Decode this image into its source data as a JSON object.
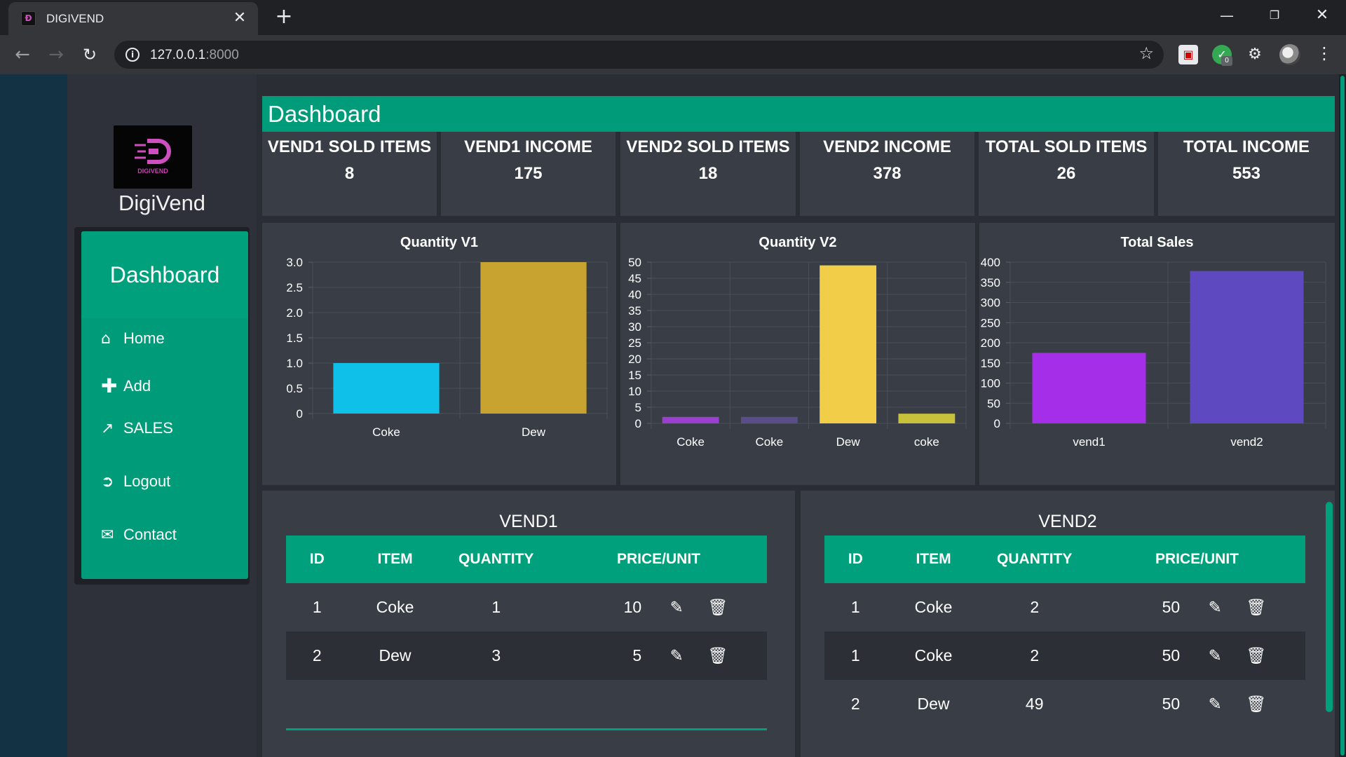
{
  "browser": {
    "tab_title": "DIGIVEND",
    "tab_favicon": "Đ",
    "tab_close": "✕",
    "new_tab": "+",
    "url_host": "127.0.0.1",
    "url_port": ":8000",
    "ext_badge": "0",
    "icons": [
      "back-icon",
      "forward-icon",
      "reload-icon",
      "info-icon",
      "star-icon",
      "puzzle-icon",
      "menu-icon"
    ]
  },
  "sidebar": {
    "logo_text": "DIGIVEND",
    "brand": "DigiVend",
    "title": "Dashboard",
    "items": [
      {
        "label": "Home",
        "icon": "home-icon"
      },
      {
        "label": "Add",
        "icon": "plus-icon"
      },
      {
        "label": "SALES",
        "icon": "chart-icon"
      },
      {
        "label": "Logout",
        "icon": "logout-icon"
      },
      {
        "label": "Contact",
        "icon": "envelope-icon"
      }
    ]
  },
  "header": {
    "title": "Dashboard"
  },
  "stats": [
    {
      "label": "VEND1 SOLD ITEMS",
      "value": "8"
    },
    {
      "label": "VEND1 INCOME",
      "value": "175"
    },
    {
      "label": "VEND2 SOLD ITEMS",
      "value": "18"
    },
    {
      "label": "VEND2 INCOME",
      "value": "378"
    },
    {
      "label": "TOTAL SOLD ITEMS",
      "value": "26"
    },
    {
      "label": "TOTAL INCOME",
      "value": "553"
    }
  ],
  "chart_data": [
    {
      "type": "bar",
      "title": "Quantity V1",
      "categories": [
        "Coke",
        "Dew"
      ],
      "values": [
        1,
        3
      ],
      "colors": [
        "#0fc0e8",
        "#c9a32f"
      ],
      "ylim": [
        0,
        3
      ],
      "yticks": [
        "0",
        "0.5",
        "1.0",
        "1.5",
        "2.0",
        "2.5",
        "3.0"
      ],
      "grid": true
    },
    {
      "type": "bar",
      "title": "Quantity V2",
      "categories": [
        "Coke",
        "Coke",
        "Dew",
        "coke"
      ],
      "values": [
        2,
        2,
        49,
        3
      ],
      "colors": [
        "#9b3fd0",
        "#5a4d8a",
        "#f2cd48",
        "#c8c23a"
      ],
      "ylim": [
        0,
        50
      ],
      "yticks": [
        "0",
        "5",
        "10",
        "15",
        "20",
        "25",
        "30",
        "35",
        "40",
        "45",
        "50"
      ],
      "grid": true
    },
    {
      "type": "bar",
      "title": "Total Sales",
      "categories": [
        "vend1",
        "vend2"
      ],
      "values": [
        175,
        378
      ],
      "colors": [
        "#a52ee8",
        "#5e49c0"
      ],
      "ylim": [
        0,
        400
      ],
      "yticks": [
        "0",
        "50",
        "100",
        "150",
        "200",
        "250",
        "300",
        "350",
        "400"
      ],
      "grid": true
    }
  ],
  "tables": {
    "vend1": {
      "title": "VEND1",
      "headers": [
        "ID",
        "ITEM",
        "QUANTITY",
        "PRICE/UNIT"
      ],
      "rows": [
        {
          "id": "1",
          "item": "Coke",
          "qty": "1",
          "price": "10"
        },
        {
          "id": "2",
          "item": "Dew",
          "qty": "3",
          "price": "5"
        }
      ]
    },
    "vend2": {
      "title": "VEND2",
      "headers": [
        "ID",
        "ITEM",
        "QUANTITY",
        "PRICE/UNIT"
      ],
      "rows": [
        {
          "id": "1",
          "item": "Coke",
          "qty": "2",
          "price": "50"
        },
        {
          "id": "1",
          "item": "Coke",
          "qty": "2",
          "price": "50"
        },
        {
          "id": "2",
          "item": "Dew",
          "qty": "49",
          "price": "50"
        }
      ]
    }
  },
  "colors": {
    "accent": "#009b78",
    "card": "#393d46",
    "page": "#2a2d33"
  }
}
